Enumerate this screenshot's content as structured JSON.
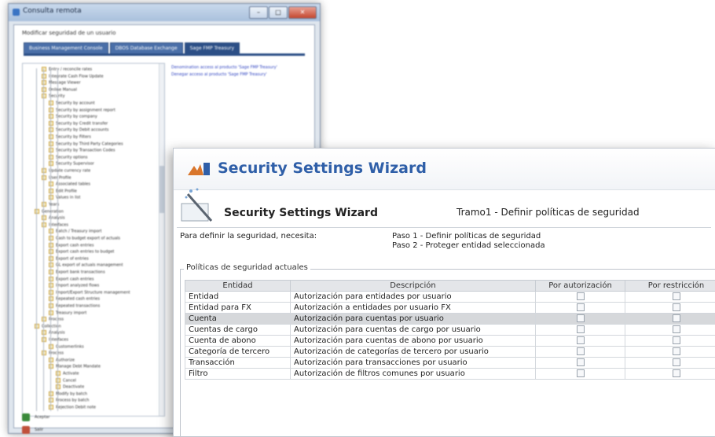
{
  "back_window": {
    "title": "Consulta remota",
    "instruction": "Modificar seguridad de un usuario",
    "tabs": [
      "Business Management Console",
      "DBOS Database Exchange",
      "Sage FMP Treasury"
    ],
    "tree_items": [
      "Entry / reconcile rates",
      "Integrate Cash Flow Update",
      "Message Viewer",
      "Online Manual",
      "Security",
      "Security by account",
      "Security by assignment report",
      "Security by company",
      "Security by Credit transfer",
      "Security by Debit accounts",
      "Security by Filters",
      "Security by Third Party Categories",
      "Security by Transaction Codes",
      "Security options",
      "Security Supervisor",
      "Update currency rate",
      "User Profile",
      "Associated tables",
      "Edit Profile",
      "Values in list",
      "Years",
      "Generation",
      "Analysis",
      "Interfaces",
      "Batch / Treasury import",
      "Cash to budget export of actuals",
      "Export cash entries",
      "Export cash entries to budget",
      "Export of entries",
      "GL export of actuals management",
      "Export bank transactions",
      "Export cash entries",
      "Import analyzed flows",
      "Import/Export Structure management",
      "Repeated cash entries",
      "Repeated transactions",
      "Treasury import",
      "Process",
      "Collection",
      "Analysis",
      "Interfaces",
      "Customerlinks",
      "Process",
      "Authorize",
      "Manage Debt Mandate",
      "Activate",
      "Cancel",
      "Deactivate",
      "Modify by batch",
      "Process by batch",
      "Rejection Debit note"
    ],
    "perm_links": [
      "Denomination access al producto 'Sage FMP Treasury'",
      "Denegar acceso al producto 'Sage FMP Treasury'"
    ],
    "bottom_buttons": [
      "Aceptar",
      "Salir"
    ]
  },
  "wizard": {
    "title": "Security Settings Wizard",
    "subtitle": "Security Settings Wizard",
    "step_label": "Tramo1 - Definir políticas de seguridad",
    "intro_left": "Para definir la seguridad, necesita:",
    "steps": [
      "Paso 1 - Definir políticas de seguridad",
      "Paso 2 - Proteger entidad seleccionada"
    ],
    "fieldset_label": "Políticas de seguridad actuales",
    "columns": [
      "Entidad",
      "Descripción",
      "Por autorización",
      "Por restricción"
    ],
    "rows": [
      {
        "entity": "Entidad",
        "description": "Autorización para entidades por usuario"
      },
      {
        "entity": "Entidad para FX",
        "description": "Autorización a entidades por usuario FX"
      },
      {
        "entity": "Cuenta",
        "description": "Autorización para cuentas por usuario"
      },
      {
        "entity": "Cuentas de cargo",
        "description": "Autorización para cuentas de cargo por usuario"
      },
      {
        "entity": "Cuenta de abono",
        "description": "Autorización para cuentas de abono por usuario"
      },
      {
        "entity": "Categoría de tercero",
        "description": "Autorización de categorías de tercero por usuario"
      },
      {
        "entity": "Transacción",
        "description": "Autorización para transacciones por usuario"
      },
      {
        "entity": "Filtro",
        "description": "Autorización de filtros comunes por usuario"
      }
    ],
    "selected_row": "Cuenta"
  },
  "colors": {
    "title_blue": "#2f5fa8",
    "tab_blue": "#2c4f86",
    "selected_row": "#d6d8db"
  }
}
